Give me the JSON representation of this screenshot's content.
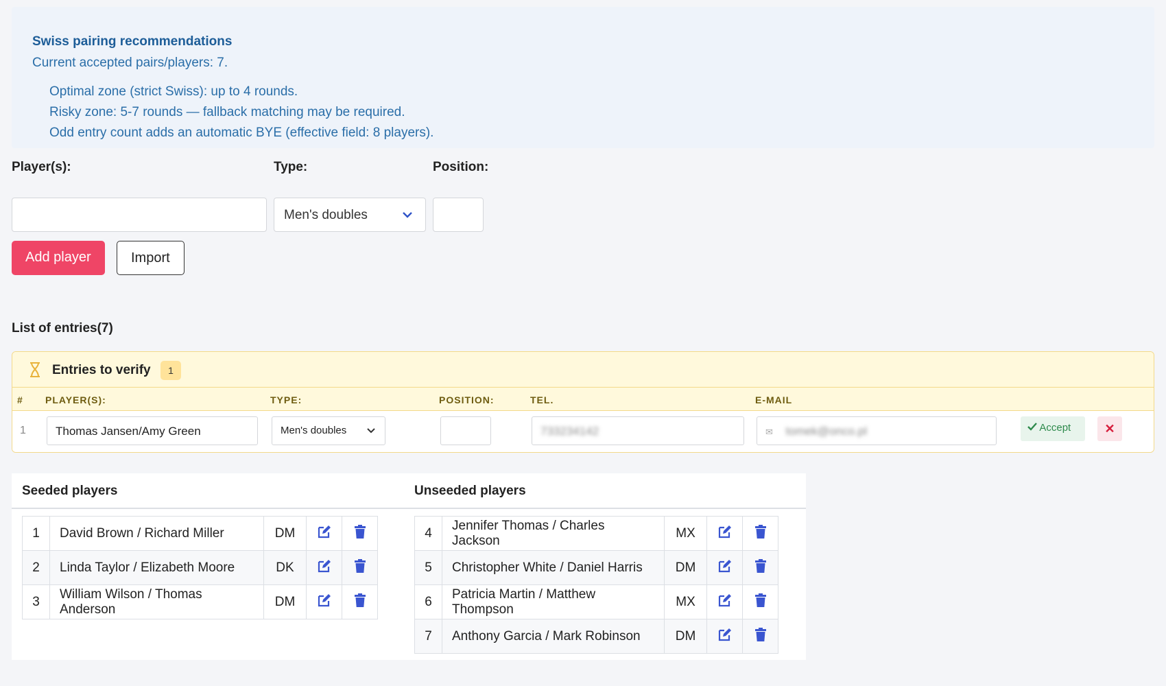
{
  "info": {
    "title": "Swiss pairing recommendations",
    "current": "Current accepted pairs/players: 7.",
    "lines": [
      "Optimal zone (strict Swiss): up to 4 rounds.",
      "Risky zone: 5-7 rounds — fallback matching may be required.",
      "Odd entry count adds an automatic BYE (effective field: 8 players)."
    ]
  },
  "form": {
    "players_label": "Player(s):",
    "type_label": "Type:",
    "type_value": "Men's doubles",
    "position_label": "Position:",
    "add_button": "Add player",
    "import_button": "Import"
  },
  "list": {
    "title": "List of entries(7)"
  },
  "verify": {
    "title": "Entries to verify",
    "badge": "1",
    "columns": [
      "#",
      "PLAYER(S):",
      "TYPE:",
      "POSITION:",
      "TEL.",
      "E-MAIL"
    ],
    "row": {
      "num": "1",
      "players": "Thomas Jansen/Amy Green",
      "type": "Men's doubles",
      "tel": "733234142",
      "email": "tomek@onco.pl",
      "accept_label": "Accept"
    }
  },
  "seeded": {
    "title": "Seeded players",
    "rows": [
      {
        "n": "1",
        "name": "David Brown / Richard Miller",
        "type": "DM"
      },
      {
        "n": "2",
        "name": "Linda Taylor / Elizabeth Moore",
        "type": "DK"
      },
      {
        "n": "3",
        "name": "William Wilson / Thomas Anderson",
        "type": "DM"
      }
    ]
  },
  "unseeded": {
    "title": "Unseeded players",
    "rows": [
      {
        "n": "4",
        "name": "Jennifer Thomas / Charles Jackson",
        "type": "MX"
      },
      {
        "n": "5",
        "name": "Christopher White / Daniel Harris",
        "type": "DM"
      },
      {
        "n": "6",
        "name": "Patricia Martin / Matthew Thompson",
        "type": "MX"
      },
      {
        "n": "7",
        "name": "Anthony Garcia / Mark Robinson",
        "type": "DM"
      }
    ]
  },
  "icons": {
    "edit": "edit-icon",
    "delete": "trash-icon",
    "accept": "check-icon",
    "reject": "close-icon",
    "verify": "hourglass-icon"
  },
  "colors": {
    "primary": "#ef4566",
    "info_text": "#2a6ea8",
    "icon": "#3a55d0",
    "verify_bg": "#fff9dc"
  }
}
